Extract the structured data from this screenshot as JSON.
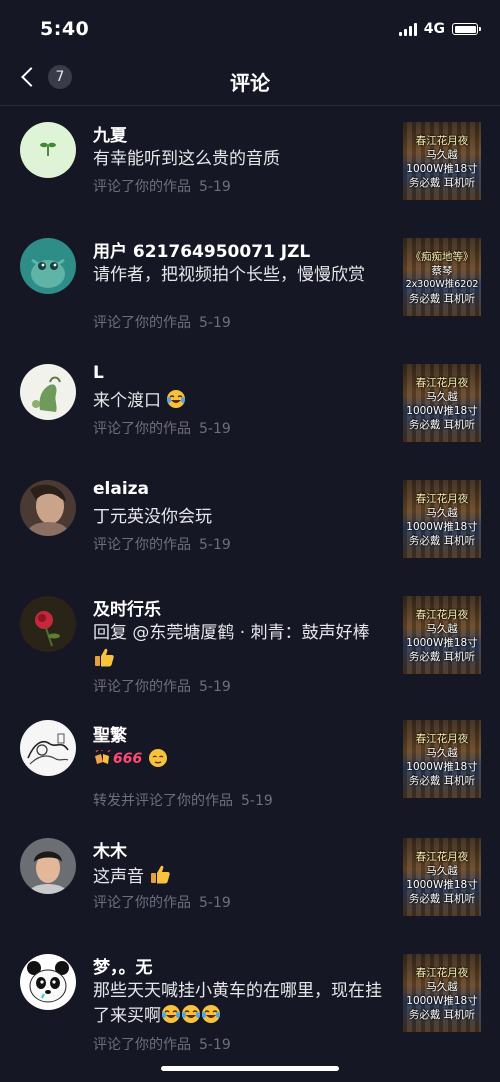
{
  "status_bar": {
    "time": "5:40",
    "network": "4G"
  },
  "nav": {
    "badge_count": "7",
    "title": "评论"
  },
  "items": [
    {
      "username": "九夏",
      "content": "有幸能听到这么贵的音质",
      "meta": "评论了你的作品",
      "date": "5-19",
      "thumb": {
        "line1": "春江花月夜",
        "line2": "马久越",
        "line3": "1000W推18寸",
        "line4": "务必戴  耳机听"
      }
    },
    {
      "username": "用户 621764950071  JZL",
      "content": "请作者，把视频拍个长些，慢慢欣赏",
      "meta": "评论了你的作品",
      "date": "5-19",
      "thumb": {
        "line1": "《痴痴地等》",
        "line2": "蔡琴",
        "line3": "2x300W推6202",
        "line4": "务必戴  耳机听"
      }
    },
    {
      "username": "L",
      "content": "来个渡口",
      "meta": "评论了你的作品",
      "date": "5-19",
      "thumb": {
        "line1": "春江花月夜",
        "line2": "马久越",
        "line3": "1000W推18寸",
        "line4": "务必戴  耳机听"
      }
    },
    {
      "username": "elaiza",
      "content": "丁元英没你会玩",
      "meta": "评论了你的作品",
      "date": "5-19",
      "thumb": {
        "line1": "春江花月夜",
        "line2": "马久越",
        "line3": "1000W推18寸",
        "line4": "务必戴  耳机听"
      }
    },
    {
      "username": "及时行乐",
      "content": "回复 @东莞塘厦鹤 · 刺青：鼓声好棒",
      "meta": "评论了你的作品",
      "date": "5-19",
      "thumb": {
        "line1": "春江花月夜",
        "line2": "马久越",
        "line3": "1000W推18寸",
        "line4": "务必戴  耳机听"
      }
    },
    {
      "username": "聖繁",
      "content": "666",
      "meta": "转发并评论了你的作品",
      "date": "5-19",
      "thumb": {
        "line1": "春江花月夜",
        "line2": "马久越",
        "line3": "1000W推18寸",
        "line4": "务必戴  耳机听"
      }
    },
    {
      "username": "木木",
      "content": "这声音",
      "meta": "评论了你的作品",
      "date": "5-19",
      "thumb": {
        "line1": "春江花月夜",
        "line2": "马久越",
        "line3": "1000W推18寸",
        "line4": "务必戴  耳机听"
      }
    },
    {
      "username": "梦，。无",
      "content": "那些天天喊挂小黄车的在哪里，现在挂了来买啊",
      "meta": "评论了你的作品",
      "date": "5-19",
      "thumb": {
        "line1": "春江花月夜",
        "line2": "马久越",
        "line3": "1000W推18寸",
        "line4": "务必戴  耳机听"
      }
    }
  ],
  "colors": {
    "background": "#161724",
    "meta_text": "#6e6f7b",
    "divider": "#2a2b38"
  },
  "icons": {
    "back": "chevron-left-icon",
    "laugh": "laugh-cry-emoji",
    "thumbs_up": "thumbs-up-emoji",
    "relieved": "relieved-emoji"
  }
}
